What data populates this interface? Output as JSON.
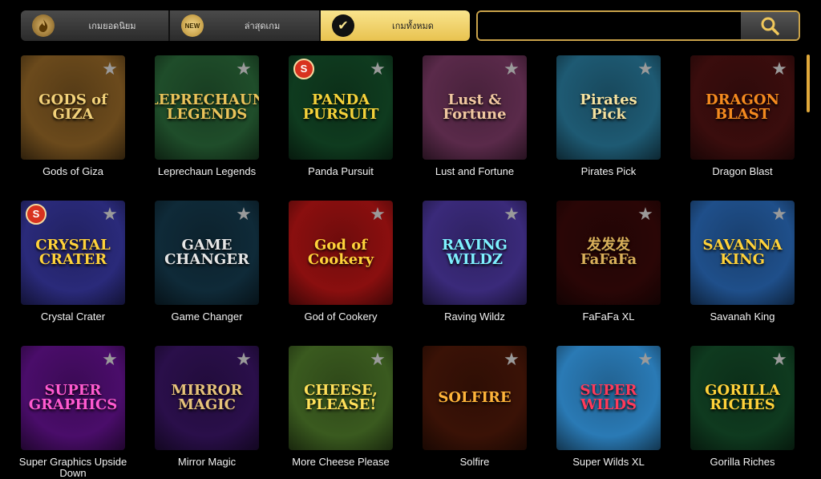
{
  "tabs": [
    {
      "label": "เกมยอดนิยม",
      "icon": "flame-icon"
    },
    {
      "label": "ล่าสุดเกม",
      "icon": "new-badge-icon",
      "icon_text": "NEW"
    },
    {
      "label": "เกมทั้งหมด",
      "icon": "check-icon",
      "active": true
    }
  ],
  "search": {
    "placeholder": "",
    "value": ""
  },
  "games": [
    {
      "title": "Gods of Giza",
      "art": "GODS of GIZA",
      "bg": "#6b4a1c",
      "fg": "#f3d27a"
    },
    {
      "title": "Leprechaun Legends",
      "art": "LEPRECHAUN LEGENDS",
      "bg": "#1f4d2a",
      "fg": "#e9c35a"
    },
    {
      "title": "Panda Pursuit",
      "art": "PANDA PURSUIT",
      "bg": "#0f3b1f",
      "fg": "#f5d23a",
      "badge": "S"
    },
    {
      "title": "Lust and Fortune",
      "art": "Lust & Fortune",
      "bg": "#5a2a4a",
      "fg": "#f0c7a0"
    },
    {
      "title": "Pirates Pick",
      "art": "Pirates Pick",
      "bg": "#1e5a73",
      "fg": "#f5e2a0"
    },
    {
      "title": "Dragon Blast",
      "art": "DRAGON BLAST",
      "bg": "#3a0d0d",
      "fg": "#f58a1f"
    },
    {
      "title": "Crystal Crater",
      "art": "CRYSTAL CRATER",
      "bg": "#2a2a7a",
      "fg": "#ffd23a",
      "badge": "S"
    },
    {
      "title": "Game Changer",
      "art": "GAME CHANGER",
      "bg": "#0f2a38",
      "fg": "#e6e6e6"
    },
    {
      "title": "God of Cookery",
      "art": "God of Cookery",
      "bg": "#8a0f0f",
      "fg": "#ffd23a"
    },
    {
      "title": "Raving Wildz",
      "art": "RAVING WILDZ",
      "bg": "#3a2a7a",
      "fg": "#7ef0ff"
    },
    {
      "title": "FaFaFa  XL",
      "art": "发发发 FaFaFa",
      "bg": "#2a0606",
      "fg": "#d9b05a"
    },
    {
      "title": "Savanah King",
      "art": "SAVANNA KING",
      "bg": "#1f4f8a",
      "fg": "#ffd23a"
    },
    {
      "title": "Super Graphics Upside Down",
      "art": "SUPER GRAPHICS",
      "bg": "#4a0d6a",
      "fg": "#ff5ad0"
    },
    {
      "title": "Mirror Magic",
      "art": "MIRROR MAGIC",
      "bg": "#2a0f4a",
      "fg": "#e6c27a"
    },
    {
      "title": "More Cheese Please",
      "art": "CHEESE, PLEASE!",
      "bg": "#3a5a1f",
      "fg": "#ffe05a"
    },
    {
      "title": "Solfire",
      "art": "SOLFIRE",
      "bg": "#3a1206",
      "fg": "#ffb43a"
    },
    {
      "title": "Super Wilds XL",
      "art": "SUPER WILDS",
      "bg": "#2a7ab5",
      "fg": "#ff3a5a"
    },
    {
      "title": "Gorilla Riches",
      "art": "GORILLA RICHES",
      "bg": "#0f3a1f",
      "fg": "#ffd23a"
    }
  ],
  "colors": {
    "accent": "#e8c24f",
    "star": "#9a9a9a",
    "scrollbar": "#e0a83a"
  }
}
